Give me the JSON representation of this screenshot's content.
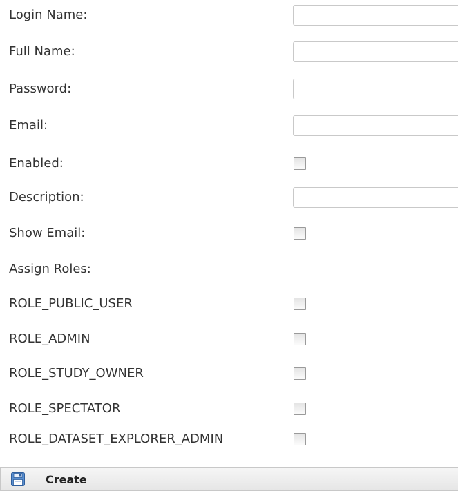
{
  "form": {
    "fields": {
      "login_name": {
        "label": "Login Name:",
        "value": "",
        "placeholder": ""
      },
      "full_name": {
        "label": "Full Name:",
        "value": "",
        "placeholder": ""
      },
      "password": {
        "label": "Password:",
        "value": "",
        "placeholder": ""
      },
      "email": {
        "label": "Email:",
        "value": "",
        "placeholder": ""
      },
      "enabled": {
        "label": "Enabled:",
        "checked": false
      },
      "description": {
        "label": "Description:",
        "value": "",
        "placeholder": ""
      },
      "show_email": {
        "label": "Show Email:",
        "checked": false
      }
    },
    "assign_roles_label": "Assign Roles:",
    "roles": [
      {
        "label": "ROLE_PUBLIC_USER",
        "checked": false
      },
      {
        "label": "ROLE_ADMIN",
        "checked": false
      },
      {
        "label": "ROLE_STUDY_OWNER",
        "checked": false
      },
      {
        "label": "ROLE_SPECTATOR",
        "checked": false
      },
      {
        "label": "ROLE_DATASET_EXPLORER_ADMIN",
        "checked": false
      }
    ]
  },
  "toolbar": {
    "create_label": "Create",
    "create_icon": "save-icon"
  }
}
